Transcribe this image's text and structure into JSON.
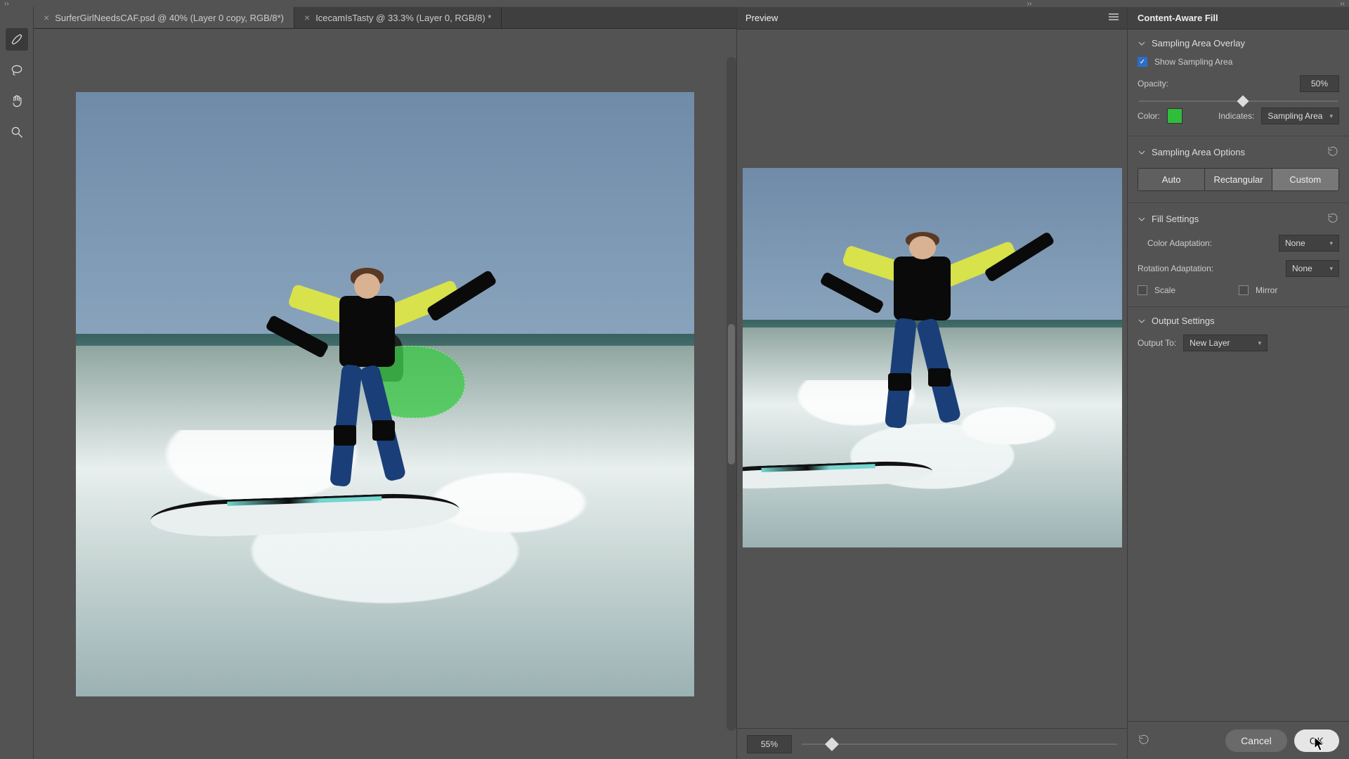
{
  "tabs": [
    {
      "label": "SurferGirlNeedsCAF.psd @ 40% (Layer 0 copy, RGB/8*)",
      "active": true
    },
    {
      "label": "IcecamIsTasty @ 33.3% (Layer 0, RGB/8) *",
      "active": false
    }
  ],
  "preview": {
    "title": "Preview",
    "zoom_value": "55%"
  },
  "options_panel": {
    "title": "Content-Aware Fill",
    "sampling_overlay": {
      "section_title": "Sampling Area Overlay",
      "show_label": "Show Sampling Area",
      "show_checked": true,
      "opacity_label": "Opacity:",
      "opacity_value": "50%",
      "opacity_pct": 50,
      "color_label": "Color:",
      "color_hex": "#2fbd3a",
      "indicates_label": "Indicates:",
      "indicates_value": "Sampling Area"
    },
    "sampling_options": {
      "section_title": "Sampling Area Options",
      "segments": [
        "Auto",
        "Rectangular",
        "Custom"
      ],
      "active_index": 2
    },
    "fill_settings": {
      "section_title": "Fill Settings",
      "color_adapt_label": "Color Adaptation:",
      "color_adapt_value": "None",
      "rotation_adapt_label": "Rotation Adaptation:",
      "rotation_adapt_value": "None",
      "scale_label": "Scale",
      "scale_checked": false,
      "mirror_label": "Mirror",
      "mirror_checked": false
    },
    "output_settings": {
      "section_title": "Output Settings",
      "output_to_label": "Output To:",
      "output_to_value": "New Layer"
    },
    "footer": {
      "cancel_label": "Cancel",
      "ok_label": "OK"
    }
  }
}
